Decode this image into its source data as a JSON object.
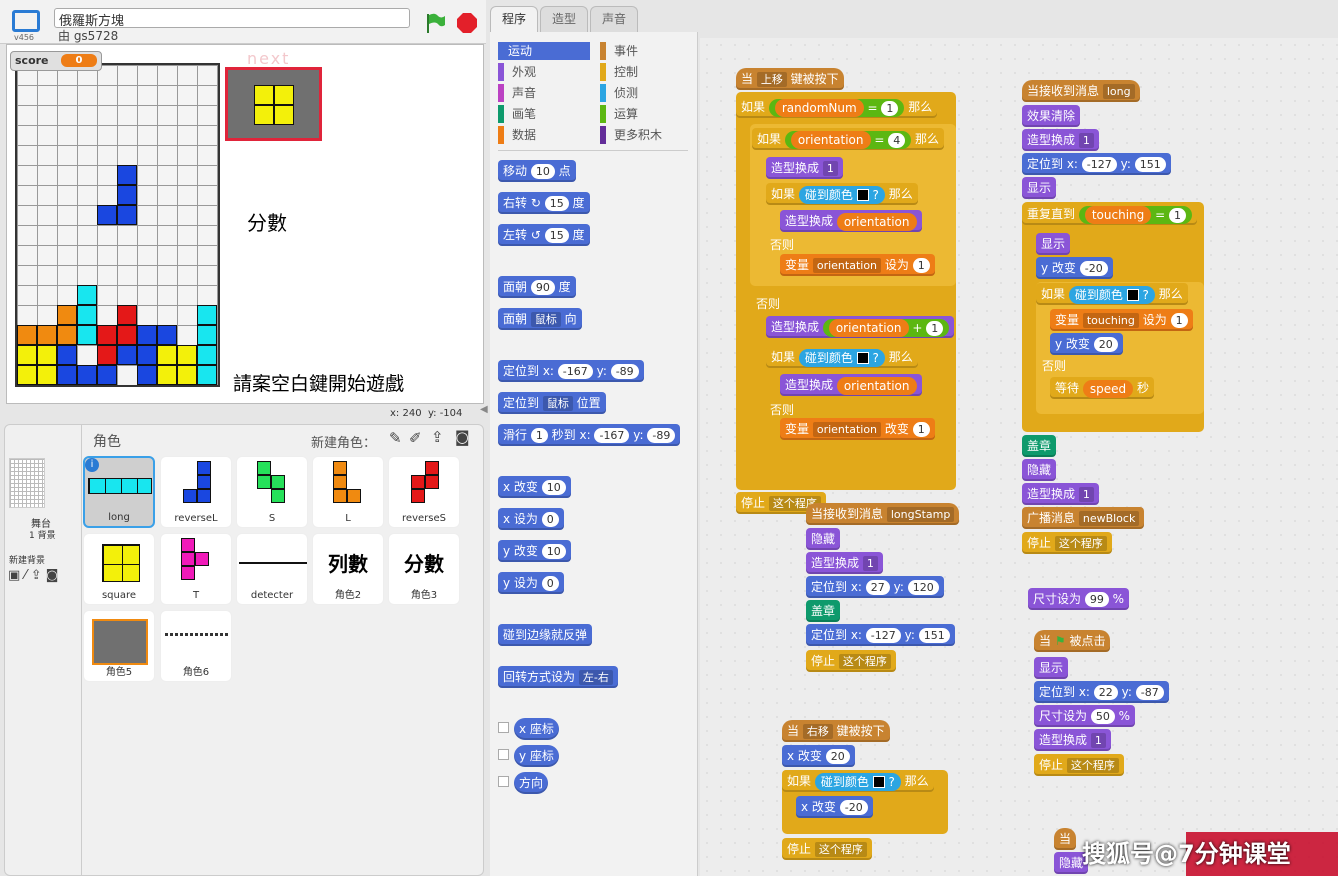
{
  "header": {
    "title": "俄羅斯方塊",
    "author": "由 gs5728",
    "version": "v456"
  },
  "stage": {
    "score_label": "score",
    "score_value": "0",
    "next_label": "next",
    "score_heading": "分數",
    "hint": "請案空白鍵開始遊戲",
    "mouse_x_label": "x:",
    "mouse_x": "240",
    "mouse_y_label": "y:",
    "mouse_y": "-104"
  },
  "sprites": {
    "header": "角色",
    "new_sprite": "新建角色：",
    "stage_label": "舞台",
    "stage_backdrops": "1 背景",
    "new_backdrop": "新建背景",
    "items": [
      {
        "name": "long"
      },
      {
        "name": "reverseL"
      },
      {
        "name": "S"
      },
      {
        "name": "L"
      },
      {
        "name": "reverseS"
      },
      {
        "name": "square"
      },
      {
        "name": "T"
      },
      {
        "name": "detecter"
      },
      {
        "name": "角色2",
        "preview": "列數"
      },
      {
        "name": "角色3",
        "preview": "分數"
      },
      {
        "name": "角色5"
      },
      {
        "name": "角色6"
      }
    ]
  },
  "tabs": [
    "程序",
    "造型",
    "声音"
  ],
  "categories": {
    "left": [
      "运动",
      "外观",
      "声音",
      "画笔",
      "数据"
    ],
    "right": [
      "事件",
      "控制",
      "侦测",
      "运算",
      "更多积木"
    ],
    "colors": [
      "#4a6cd4",
      "#8a55d7",
      "#bb42c3",
      "#0e9a6c",
      "#ee7d16",
      "#c88330",
      "#e1a91a",
      "#2ca5e2",
      "#5cb712",
      "#632d99"
    ]
  },
  "palette": {
    "move": "移动",
    "move_n": "10",
    "move_u": "点",
    "turn_r": "右转",
    "turn_r_n": "15",
    "turn_u": "度",
    "turn_l": "左转",
    "turn_l_n": "15",
    "point_dir": "面朝",
    "point_dir_n": "90",
    "deg": "度",
    "point_towards": "面朝",
    "point_towards_v": "鼠标",
    "point_towards_u": "向",
    "goto_xy": "定位到 x:",
    "goto_x": "-167",
    "y_label": "y:",
    "goto_y": "-89",
    "goto": "定位到",
    "goto_v": "鼠标",
    "goto_u": "位置",
    "glide": "滑行",
    "glide_n": "1",
    "glide_u": "秒到 x:",
    "glide_x": "-167",
    "glide_y": "-89",
    "change_x": "x 改变",
    "change_x_n": "10",
    "set_x": "x 设为",
    "set_x_n": "0",
    "change_y": "y 改变",
    "change_y_n": "10",
    "set_y": "y 设为",
    "set_y_n": "0",
    "bounce": "碰到边缘就反弹",
    "rot": "回转方式设为",
    "rot_v": "左-右",
    "xpos": "x 座标",
    "ypos": "y 座标",
    "dir": "方向"
  },
  "scripts": {
    "when_key": "当",
    "key_up": "上移",
    "key_pressed": "键被按下",
    "if": "如果",
    "then": "那么",
    "else": "否则",
    "randomNum": "randomNum",
    "eq": "=",
    "one": "1",
    "four": "4",
    "orientation": "orientation",
    "switch_costume": "造型换成",
    "touching_color": "碰到颜色",
    "q": "?",
    "set_var": "变量",
    "set_to": "设为",
    "change_by": "改变",
    "plus": "+",
    "stop": "停止",
    "this_script": "这个程序",
    "recv": "当接收到消息",
    "msg_long": "long",
    "msg_longStamp": "longStamp",
    "clear_effects": "效果清除",
    "goto_xy": "定位到 x:",
    "y": "y:",
    "x1": "-127",
    "y1": "151",
    "x2": "27",
    "y2": "120",
    "x3": "22",
    "y3": "-87",
    "show": "显示",
    "hide": "隐藏",
    "stamp": "盖章",
    "repeat_until": "重复直到",
    "touching": "touching",
    "y_change": "y 改变",
    "y_n20": "-20",
    "y_p20": "20",
    "wait": "等待",
    "speed": "speed",
    "sec": "秒",
    "broadcast": "广播消息",
    "newBlock": "newBlock",
    "size_set": "尺寸设为",
    "size99": "99",
    "size50": "50",
    "pct": "%",
    "flag_clicked": "被点击",
    "key_right": "右移",
    "x_change": "x 改变",
    "x_p20": "20",
    "x_n20": "-20"
  },
  "watermark": "搜狐号@7分钟课堂"
}
